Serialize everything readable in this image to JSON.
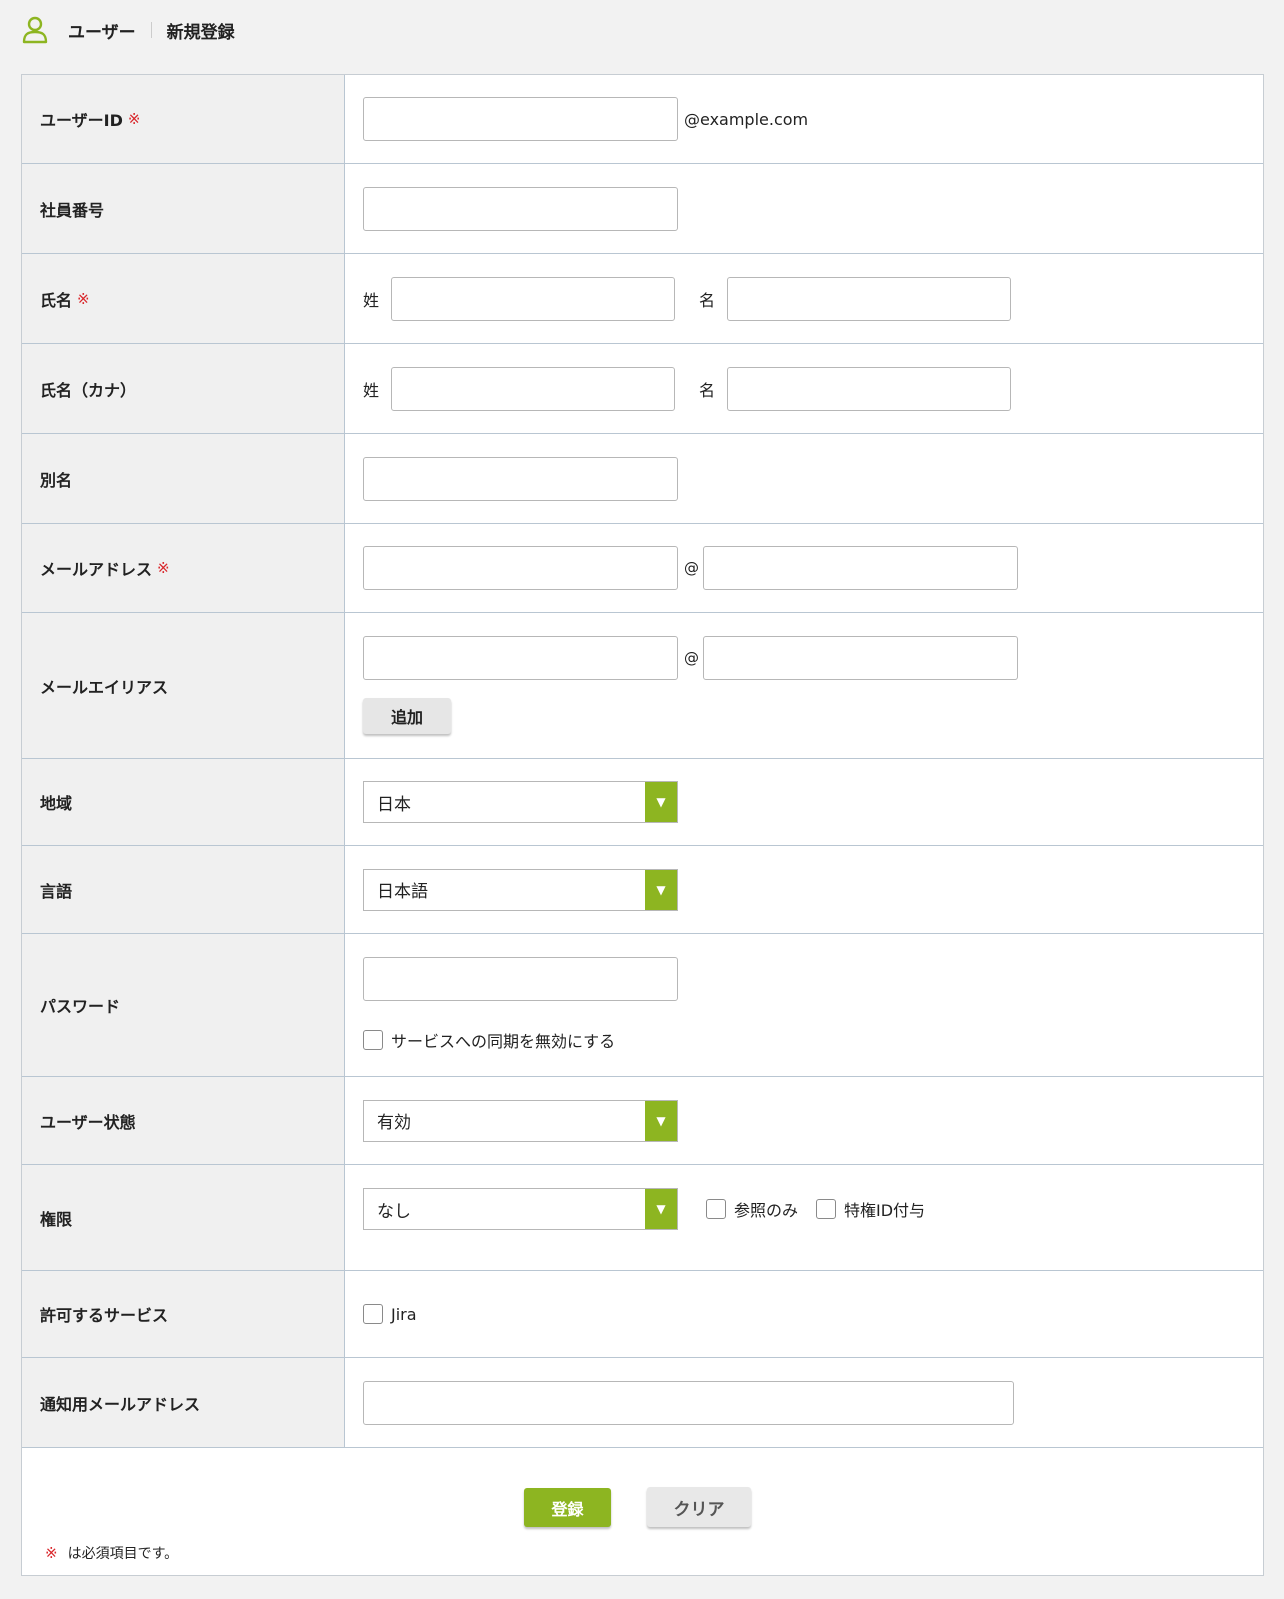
{
  "breadcrumb": {
    "section": "ユーザー",
    "page": "新規登録"
  },
  "required_mark": "※",
  "form": {
    "user_id": {
      "label": "ユーザーID",
      "value": "",
      "suffix": "@example.com"
    },
    "employee_number": {
      "label": "社員番号",
      "value": ""
    },
    "name": {
      "label": "氏名",
      "last_label": "姓",
      "first_label": "名",
      "last_value": "",
      "first_value": ""
    },
    "name_kana": {
      "label": "氏名（カナ）",
      "last_label": "姓",
      "first_label": "名",
      "last_value": "",
      "first_value": ""
    },
    "alias": {
      "label": "別名",
      "value": ""
    },
    "email": {
      "label": "メールアドレス",
      "at": "@",
      "local": "",
      "domain": ""
    },
    "email_alias": {
      "label": "メールエイリアス",
      "at": "@",
      "local": "",
      "domain": "",
      "add_label": "追加"
    },
    "region": {
      "label": "地域",
      "selected": "日本"
    },
    "language": {
      "label": "言語",
      "selected": "日本語"
    },
    "password": {
      "label": "パスワード",
      "value": "",
      "disable_sync_label": "サービスへの同期を無効にする",
      "disable_sync_checked": false
    },
    "user_status": {
      "label": "ユーザー状態",
      "selected": "有効"
    },
    "permission": {
      "label": "権限",
      "selected": "なし",
      "read_only_label": "参照のみ",
      "privileged_id_label": "特権ID付与"
    },
    "allowed_services": {
      "label": "許可するサービス",
      "services": [
        "Jira"
      ]
    },
    "notify_email": {
      "label": "通知用メールアドレス",
      "value": ""
    }
  },
  "footer": {
    "required_note": "は必須項目です。",
    "submit_label": "登録",
    "clear_label": "クリア"
  },
  "colors": {
    "accent": "#8db521",
    "required": "#d9262b",
    "label_bg": "#f0f0f0"
  }
}
